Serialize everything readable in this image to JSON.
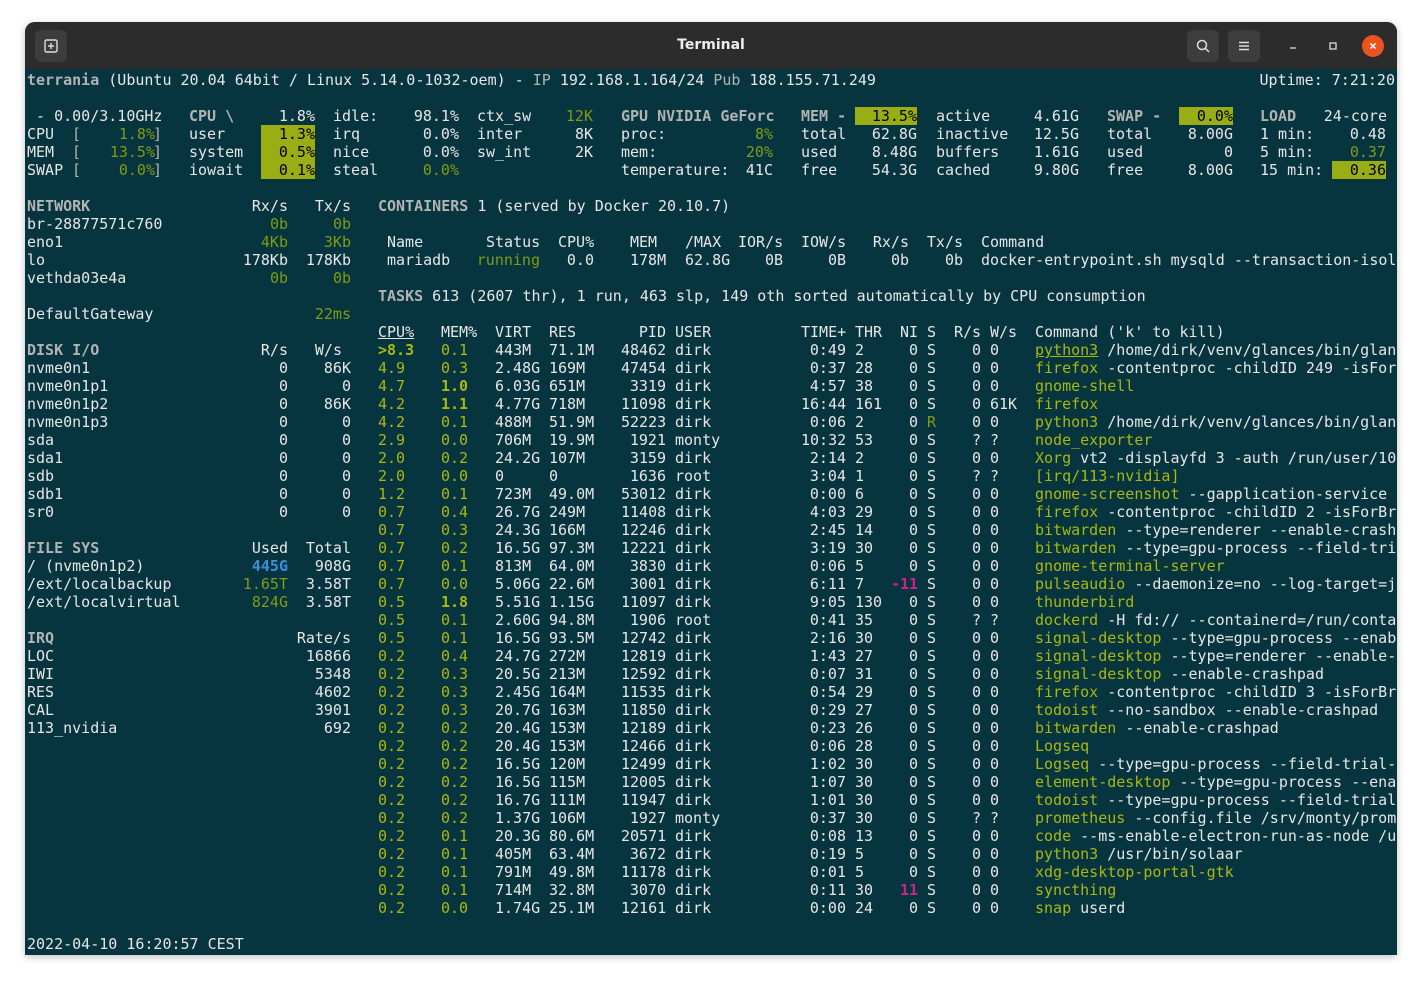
{
  "window": {
    "title": "Terminal"
  },
  "header": {
    "host": "terrania",
    "os": " (Ubuntu 20.04 64bit / Linux 5.14.0-1032-oem) - ",
    "ip_label": "IP ",
    "ip": "192.168.1.164/24",
    "pub_label": " Pub ",
    "pub": "188.155.71.249",
    "uptime": "Uptime: 7:21:20"
  },
  "quicklook": {
    "freq": " - 0.00/3.10GHz",
    "cpu_label": "CPU",
    "cpu_val": "1.8%",
    "mem_label": "MEM",
    "mem_val": "13.5%",
    "swap_label": "SWAP",
    "swap_val": "0.0%",
    "open": "[",
    "close": "]",
    "cpu_fill": 0.018,
    "mem_fill": 0.135,
    "swap_fill": 0.0
  },
  "cpu": {
    "title": "CPU \\",
    "total": "1.8%",
    "rows": [
      {
        "k": "user",
        "v": "1.3%"
      },
      {
        "k": "system",
        "v": "0.5%"
      },
      {
        "k": "iowait",
        "v": "0.1%"
      }
    ],
    "rows2": [
      {
        "k": "idle:",
        "v": "98.1%"
      },
      {
        "k": "irq",
        "v": "0.0%"
      },
      {
        "k": "nice",
        "v": "0.0%"
      },
      {
        "k": "steal",
        "v": "0.0%"
      }
    ],
    "rows3": [
      {
        "k": "ctx_sw",
        "v": "12K"
      },
      {
        "k": "inter",
        "v": "8K"
      },
      {
        "k": "sw_int",
        "v": "2K"
      }
    ]
  },
  "gpu": {
    "title": "GPU NVIDIA GeForc",
    "proc_label": "proc:",
    "proc": "8%",
    "mem_label": "mem:",
    "mem": "20%",
    "temp_label": "temperature:",
    "temp": "41C"
  },
  "mem": {
    "title": "MEM -",
    "pct": "13.5%",
    "rows": [
      {
        "k": "total",
        "v": "62.8G"
      },
      {
        "k": "used",
        "v": "8.48G"
      },
      {
        "k": "free",
        "v": "54.3G"
      }
    ],
    "rows2": [
      {
        "k": "active",
        "v": "4.61G"
      },
      {
        "k": "inactive",
        "v": "12.5G"
      },
      {
        "k": "buffers",
        "v": "1.61G"
      },
      {
        "k": "cached",
        "v": "9.80G"
      }
    ]
  },
  "swap": {
    "title": "SWAP -",
    "pct": "0.0%",
    "rows": [
      {
        "k": "total",
        "v": "8.00G"
      },
      {
        "k": "used",
        "v": "0"
      },
      {
        "k": "free",
        "v": "8.00G"
      }
    ]
  },
  "load": {
    "title": "LOAD",
    "cores": "24-core",
    "rows": [
      {
        "k": "1 min:",
        "v": "0.48"
      },
      {
        "k": "5 min:",
        "v": "0.37"
      },
      {
        "k": "15 min:",
        "v": "0.36"
      }
    ]
  },
  "network": {
    "title": "NETWORK",
    "rx": "Rx/s",
    "tx": "Tx/s",
    "rows": [
      {
        "n": "br-28877571c760",
        "rx": "0b",
        "tx": "0b"
      },
      {
        "n": "eno1",
        "rx": "4Kb",
        "tx": "3Kb"
      },
      {
        "n": "lo",
        "rx": "178Kb",
        "tx": "178Kb"
      },
      {
        "n": "vethda03e4a",
        "rx": "0b",
        "tx": "0b"
      }
    ],
    "gw": "DefaultGateway",
    "gw_val": "22ms"
  },
  "diskio": {
    "title": "DISK I/O",
    "r": "R/s",
    "w": "W/s",
    "rows": [
      {
        "n": "nvme0n1",
        "r": "0",
        "w": "86K"
      },
      {
        "n": "nvme0n1p1",
        "r": "0",
        "w": "0"
      },
      {
        "n": "nvme0n1p2",
        "r": "0",
        "w": "86K"
      },
      {
        "n": "nvme0n1p3",
        "r": "0",
        "w": "0"
      },
      {
        "n": "sda",
        "r": "0",
        "w": "0"
      },
      {
        "n": "sda1",
        "r": "0",
        "w": "0"
      },
      {
        "n": "sdb",
        "r": "0",
        "w": "0"
      },
      {
        "n": "sdb1",
        "r": "0",
        "w": "0"
      },
      {
        "n": "sr0",
        "r": "0",
        "w": "0"
      }
    ]
  },
  "fs": {
    "title": "FILE SYS",
    "used": "Used",
    "total": "Total",
    "rows": [
      {
        "n": "/ (nvme0n1p2)",
        "u": "445G",
        "t": "908G"
      },
      {
        "n": "/ext/localbackup",
        "u": "1.65T",
        "t": "3.58T"
      },
      {
        "n": "/ext/localvirtual",
        "u": "824G",
        "t": "3.58T"
      }
    ]
  },
  "irq": {
    "title": "IRQ",
    "rate": "Rate/s",
    "rows": [
      {
        "n": "LOC",
        "v": "16866"
      },
      {
        "n": "IWI",
        "v": "5348"
      },
      {
        "n": "RES",
        "v": "4602"
      },
      {
        "n": "CAL",
        "v": "3901"
      },
      {
        "n": "113_nvidia",
        "v": "692"
      }
    ]
  },
  "containers": {
    "title": "CONTAINERS",
    "info": " 1 (served by Docker 20.10.7)",
    "headers": [
      "Name",
      "Status",
      "CPU%",
      "MEM",
      "/MAX",
      "IOR/s",
      "IOW/s",
      "Rx/s",
      "Tx/s",
      "Command"
    ],
    "row": [
      "mariadb",
      "running",
      "0.0",
      "178M",
      "62.8G",
      "0B",
      "0B",
      "0b",
      "0b",
      "docker-entrypoint.sh mysqld --transaction-isol"
    ]
  },
  "tasks": {
    "title": "TASKS",
    "info": " 613 (2607 thr), 1 run, 463 slp, 149 oth sorted automatically by CPU consumption"
  },
  "procs": {
    "headers": [
      "CPU%",
      "MEM%",
      "VIRT",
      "RES",
      "PID",
      "USER",
      "TIME+",
      "THR",
      "NI",
      "S",
      "R/s",
      "W/s",
      "Command ('k' to kill)"
    ],
    "rows": [
      [
        ">8.3",
        "0.1",
        "443M",
        "71.1M",
        "48462",
        "dirk",
        "0:49",
        "2",
        "0",
        "S",
        "0",
        "0",
        "python3",
        "/home/dirk/venv/glances/bin/glan"
      ],
      [
        "4.9",
        "0.3",
        "2.48G",
        "169M",
        "47454",
        "dirk",
        "0:37",
        "28",
        "0",
        "S",
        "0",
        "0",
        "firefox",
        "-contentproc -childID 249 -isFor"
      ],
      [
        "4.7",
        "1.0",
        "6.03G",
        "651M",
        "3319",
        "dirk",
        "4:57",
        "38",
        "0",
        "S",
        "0",
        "0",
        "gnome-shell",
        ""
      ],
      [
        "4.2",
        "1.1",
        "4.77G",
        "718M",
        "11098",
        "dirk",
        "16:44",
        "161",
        "0",
        "S",
        "0",
        "61K",
        "firefox",
        ""
      ],
      [
        "4.2",
        "0.1",
        "488M",
        "51.9M",
        "52223",
        "dirk",
        "0:06",
        "2",
        "0",
        "R",
        "0",
        "0",
        "python3",
        "/home/dirk/venv/glances/bin/glan"
      ],
      [
        "2.9",
        "0.0",
        "706M",
        "19.9M",
        "1921",
        "monty",
        "10:32",
        "53",
        "0",
        "S",
        "?",
        "?",
        "node_exporter",
        ""
      ],
      [
        "2.0",
        "0.2",
        "24.2G",
        "107M",
        "3159",
        "dirk",
        "2:14",
        "2",
        "0",
        "S",
        "0",
        "0",
        "Xorg",
        "vt2 -displayfd 3 -auth /run/user/10"
      ],
      [
        "2.0",
        "0.0",
        "0",
        "0",
        "1636",
        "root",
        "3:04",
        "1",
        "0",
        "S",
        "?",
        "?",
        "[irq/113-nvidia]",
        ""
      ],
      [
        "1.2",
        "0.1",
        "723M",
        "49.0M",
        "53012",
        "dirk",
        "0:00",
        "6",
        "0",
        "S",
        "0",
        "0",
        "gnome-screenshot",
        "--gapplication-service"
      ],
      [
        "0.7",
        "0.4",
        "26.7G",
        "249M",
        "11408",
        "dirk",
        "4:03",
        "29",
        "0",
        "S",
        "0",
        "0",
        "firefox",
        "-contentproc -childID 2 -isForBr"
      ],
      [
        "0.7",
        "0.3",
        "24.3G",
        "166M",
        "12246",
        "dirk",
        "2:45",
        "14",
        "0",
        "S",
        "0",
        "0",
        "bitwarden",
        "--type=renderer --enable-crash"
      ],
      [
        "0.7",
        "0.2",
        "16.5G",
        "97.3M",
        "12221",
        "dirk",
        "3:19",
        "30",
        "0",
        "S",
        "0",
        "0",
        "bitwarden",
        "--type=gpu-process --field-tri"
      ],
      [
        "0.7",
        "0.1",
        "813M",
        "64.0M",
        "3830",
        "dirk",
        "0:06",
        "5",
        "0",
        "S",
        "0",
        "0",
        "gnome-terminal-server",
        ""
      ],
      [
        "0.7",
        "0.0",
        "5.06G",
        "22.6M",
        "3001",
        "dirk",
        "6:11",
        "7",
        "-11",
        "S",
        "0",
        "0",
        "pulseaudio",
        "--daemonize=no --log-target=j"
      ],
      [
        "0.5",
        "1.8",
        "5.51G",
        "1.15G",
        "11097",
        "dirk",
        "9:05",
        "130",
        "0",
        "S",
        "0",
        "0",
        "thunderbird",
        ""
      ],
      [
        "0.5",
        "0.1",
        "2.60G",
        "94.8M",
        "1906",
        "root",
        "0:41",
        "35",
        "0",
        "S",
        "?",
        "?",
        "dockerd",
        "-H fd:// --containerd=/run/conta"
      ],
      [
        "0.5",
        "0.1",
        "16.5G",
        "93.5M",
        "12742",
        "dirk",
        "2:16",
        "30",
        "0",
        "S",
        "0",
        "0",
        "signal-desktop",
        "--type=gpu-process --enab"
      ],
      [
        "0.2",
        "0.4",
        "24.7G",
        "272M",
        "12819",
        "dirk",
        "1:43",
        "27",
        "0",
        "S",
        "0",
        "0",
        "signal-desktop",
        "--type=renderer --enable-"
      ],
      [
        "0.2",
        "0.3",
        "20.5G",
        "213M",
        "12592",
        "dirk",
        "0:07",
        "31",
        "0",
        "S",
        "0",
        "0",
        "signal-desktop",
        "--enable-crashpad"
      ],
      [
        "0.2",
        "0.3",
        "2.45G",
        "164M",
        "11535",
        "dirk",
        "0:54",
        "29",
        "0",
        "S",
        "0",
        "0",
        "firefox",
        "-contentproc -childID 3 -isForBr"
      ],
      [
        "0.2",
        "0.3",
        "20.7G",
        "163M",
        "11850",
        "dirk",
        "0:29",
        "27",
        "0",
        "S",
        "0",
        "0",
        "todoist",
        "--no-sandbox --enable-crashpad"
      ],
      [
        "0.2",
        "0.2",
        "20.4G",
        "153M",
        "12189",
        "dirk",
        "0:23",
        "26",
        "0",
        "S",
        "0",
        "0",
        "bitwarden",
        "--enable-crashpad"
      ],
      [
        "0.2",
        "0.2",
        "20.4G",
        "153M",
        "12466",
        "dirk",
        "0:06",
        "28",
        "0",
        "S",
        "0",
        "0",
        "Logseq",
        ""
      ],
      [
        "0.2",
        "0.2",
        "16.5G",
        "120M",
        "12499",
        "dirk",
        "1:02",
        "30",
        "0",
        "S",
        "0",
        "0",
        "Logseq",
        "--type=gpu-process --field-trial-"
      ],
      [
        "0.2",
        "0.2",
        "16.5G",
        "115M",
        "12005",
        "dirk",
        "1:07",
        "30",
        "0",
        "S",
        "0",
        "0",
        "element-desktop",
        "--type=gpu-process --ena"
      ],
      [
        "0.2",
        "0.2",
        "16.7G",
        "111M",
        "11947",
        "dirk",
        "1:01",
        "30",
        "0",
        "S",
        "0",
        "0",
        "todoist",
        "--type=gpu-process --field-trial"
      ],
      [
        "0.2",
        "0.2",
        "1.37G",
        "106M",
        "1927",
        "monty",
        "0:37",
        "30",
        "0",
        "S",
        "?",
        "?",
        "prometheus",
        "--config.file /srv/monty/prom"
      ],
      [
        "0.2",
        "0.1",
        "20.3G",
        "80.6M",
        "20571",
        "dirk",
        "0:08",
        "13",
        "0",
        "S",
        "0",
        "0",
        "code",
        "--ms-enable-electron-run-as-node /u"
      ],
      [
        "0.2",
        "0.1",
        "405M",
        "63.4M",
        "3672",
        "dirk",
        "0:19",
        "5",
        "0",
        "S",
        "0",
        "0",
        "python3",
        "/usr/bin/solaar"
      ],
      [
        "0.2",
        "0.1",
        "791M",
        "49.8M",
        "11178",
        "dirk",
        "0:01",
        "5",
        "0",
        "S",
        "0",
        "0",
        "xdg-desktop-portal-gtk",
        ""
      ],
      [
        "0.2",
        "0.1",
        "714M",
        "32.8M",
        "3070",
        "dirk",
        "0:11",
        "30",
        "11",
        "S",
        "0",
        "0",
        "syncthing",
        ""
      ],
      [
        "0.2",
        "0.0",
        "1.74G",
        "25.1M",
        "12161",
        "dirk",
        "0:00",
        "24",
        "0",
        "S",
        "0",
        "0",
        "snap",
        "userd"
      ]
    ]
  },
  "footer": {
    "time": "2022-04-10 16:20:57 CEST"
  }
}
